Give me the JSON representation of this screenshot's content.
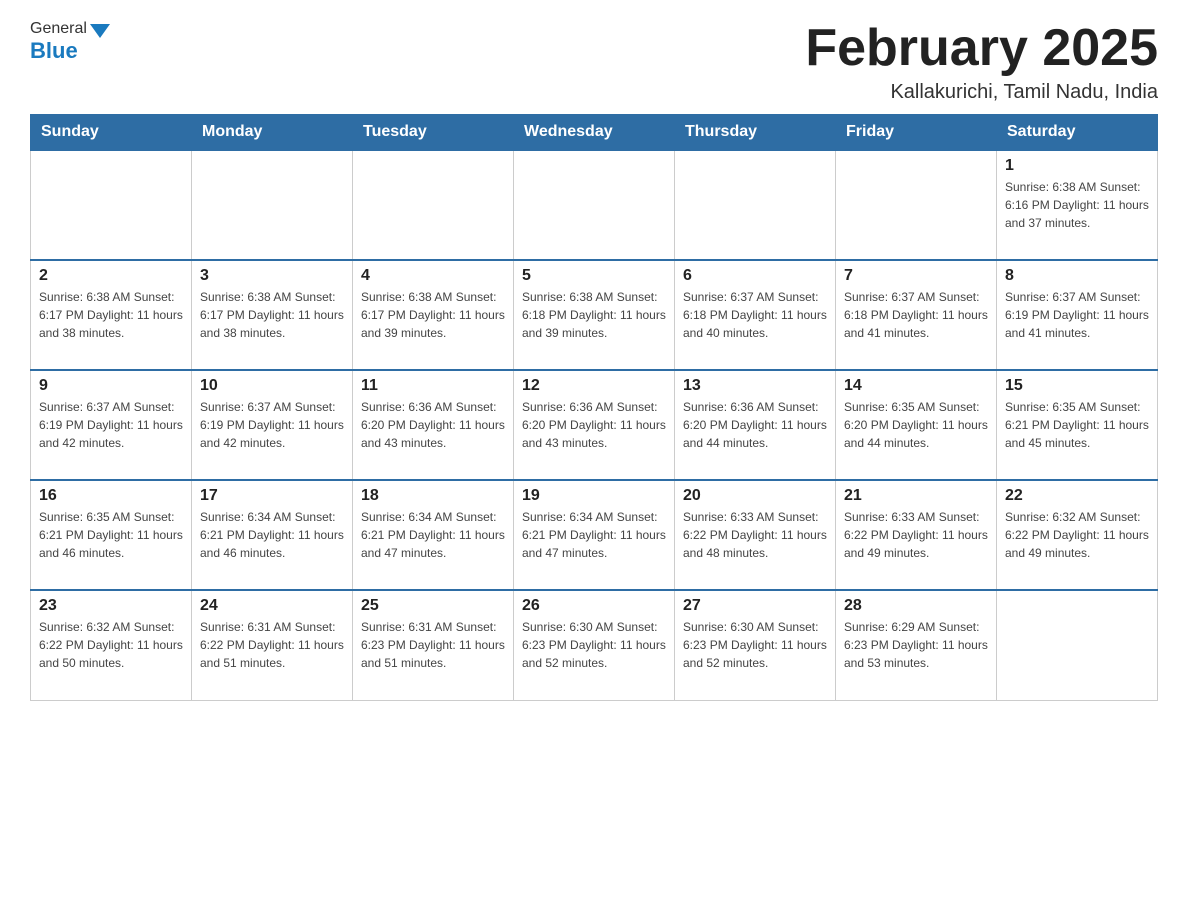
{
  "header": {
    "logo_general": "General",
    "logo_blue": "Blue",
    "month_title": "February 2025",
    "location": "Kallakurichi, Tamil Nadu, India"
  },
  "calendar": {
    "days_of_week": [
      "Sunday",
      "Monday",
      "Tuesday",
      "Wednesday",
      "Thursday",
      "Friday",
      "Saturday"
    ],
    "weeks": [
      [
        {
          "day": "",
          "info": ""
        },
        {
          "day": "",
          "info": ""
        },
        {
          "day": "",
          "info": ""
        },
        {
          "day": "",
          "info": ""
        },
        {
          "day": "",
          "info": ""
        },
        {
          "day": "",
          "info": ""
        },
        {
          "day": "1",
          "info": "Sunrise: 6:38 AM\nSunset: 6:16 PM\nDaylight: 11 hours and 37 minutes."
        }
      ],
      [
        {
          "day": "2",
          "info": "Sunrise: 6:38 AM\nSunset: 6:17 PM\nDaylight: 11 hours and 38 minutes."
        },
        {
          "day": "3",
          "info": "Sunrise: 6:38 AM\nSunset: 6:17 PM\nDaylight: 11 hours and 38 minutes."
        },
        {
          "day": "4",
          "info": "Sunrise: 6:38 AM\nSunset: 6:17 PM\nDaylight: 11 hours and 39 minutes."
        },
        {
          "day": "5",
          "info": "Sunrise: 6:38 AM\nSunset: 6:18 PM\nDaylight: 11 hours and 39 minutes."
        },
        {
          "day": "6",
          "info": "Sunrise: 6:37 AM\nSunset: 6:18 PM\nDaylight: 11 hours and 40 minutes."
        },
        {
          "day": "7",
          "info": "Sunrise: 6:37 AM\nSunset: 6:18 PM\nDaylight: 11 hours and 41 minutes."
        },
        {
          "day": "8",
          "info": "Sunrise: 6:37 AM\nSunset: 6:19 PM\nDaylight: 11 hours and 41 minutes."
        }
      ],
      [
        {
          "day": "9",
          "info": "Sunrise: 6:37 AM\nSunset: 6:19 PM\nDaylight: 11 hours and 42 minutes."
        },
        {
          "day": "10",
          "info": "Sunrise: 6:37 AM\nSunset: 6:19 PM\nDaylight: 11 hours and 42 minutes."
        },
        {
          "day": "11",
          "info": "Sunrise: 6:36 AM\nSunset: 6:20 PM\nDaylight: 11 hours and 43 minutes."
        },
        {
          "day": "12",
          "info": "Sunrise: 6:36 AM\nSunset: 6:20 PM\nDaylight: 11 hours and 43 minutes."
        },
        {
          "day": "13",
          "info": "Sunrise: 6:36 AM\nSunset: 6:20 PM\nDaylight: 11 hours and 44 minutes."
        },
        {
          "day": "14",
          "info": "Sunrise: 6:35 AM\nSunset: 6:20 PM\nDaylight: 11 hours and 44 minutes."
        },
        {
          "day": "15",
          "info": "Sunrise: 6:35 AM\nSunset: 6:21 PM\nDaylight: 11 hours and 45 minutes."
        }
      ],
      [
        {
          "day": "16",
          "info": "Sunrise: 6:35 AM\nSunset: 6:21 PM\nDaylight: 11 hours and 46 minutes."
        },
        {
          "day": "17",
          "info": "Sunrise: 6:34 AM\nSunset: 6:21 PM\nDaylight: 11 hours and 46 minutes."
        },
        {
          "day": "18",
          "info": "Sunrise: 6:34 AM\nSunset: 6:21 PM\nDaylight: 11 hours and 47 minutes."
        },
        {
          "day": "19",
          "info": "Sunrise: 6:34 AM\nSunset: 6:21 PM\nDaylight: 11 hours and 47 minutes."
        },
        {
          "day": "20",
          "info": "Sunrise: 6:33 AM\nSunset: 6:22 PM\nDaylight: 11 hours and 48 minutes."
        },
        {
          "day": "21",
          "info": "Sunrise: 6:33 AM\nSunset: 6:22 PM\nDaylight: 11 hours and 49 minutes."
        },
        {
          "day": "22",
          "info": "Sunrise: 6:32 AM\nSunset: 6:22 PM\nDaylight: 11 hours and 49 minutes."
        }
      ],
      [
        {
          "day": "23",
          "info": "Sunrise: 6:32 AM\nSunset: 6:22 PM\nDaylight: 11 hours and 50 minutes."
        },
        {
          "day": "24",
          "info": "Sunrise: 6:31 AM\nSunset: 6:22 PM\nDaylight: 11 hours and 51 minutes."
        },
        {
          "day": "25",
          "info": "Sunrise: 6:31 AM\nSunset: 6:23 PM\nDaylight: 11 hours and 51 minutes."
        },
        {
          "day": "26",
          "info": "Sunrise: 6:30 AM\nSunset: 6:23 PM\nDaylight: 11 hours and 52 minutes."
        },
        {
          "day": "27",
          "info": "Sunrise: 6:30 AM\nSunset: 6:23 PM\nDaylight: 11 hours and 52 minutes."
        },
        {
          "day": "28",
          "info": "Sunrise: 6:29 AM\nSunset: 6:23 PM\nDaylight: 11 hours and 53 minutes."
        },
        {
          "day": "",
          "info": ""
        }
      ]
    ]
  }
}
